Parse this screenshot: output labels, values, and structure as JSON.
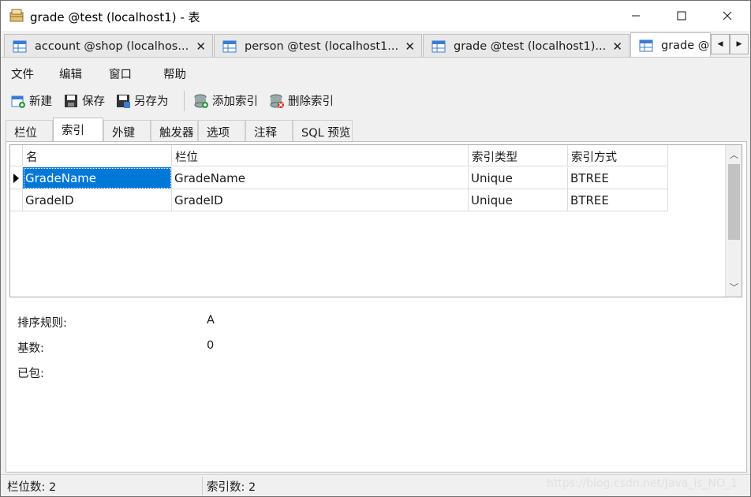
{
  "window": {
    "title": "grade @test (localhost1) - 表",
    "controls": {
      "minimize": "minimize",
      "maximize": "maximize",
      "close": "close"
    }
  },
  "doc_tabs": [
    {
      "label": "account @shop (localhos...",
      "active": false
    },
    {
      "label": "person @test (localhost1...",
      "active": false
    },
    {
      "label": "grade @test (localhost1)...",
      "active": false
    },
    {
      "label": "grade @t",
      "active": true
    }
  ],
  "menu": [
    "文件",
    "编辑",
    "窗口",
    "帮助"
  ],
  "toolbar": {
    "new": "新建",
    "save": "保存",
    "save_as": "另存为",
    "add_index": "添加索引",
    "delete_index": "删除索引"
  },
  "subtabs": [
    "栏位",
    "索引",
    "外键",
    "触发器",
    "选项",
    "注释",
    "SQL 预览"
  ],
  "active_subtab": "索引",
  "index_grid": {
    "columns": [
      "名",
      "栏位",
      "索引类型",
      "索引方式"
    ],
    "rows": [
      [
        "GradeName",
        "GradeName",
        "Unique",
        "BTREE"
      ],
      [
        "GradeID",
        "GradeID",
        "Unique",
        "BTREE"
      ]
    ]
  },
  "properties": [
    {
      "label": "排序规则:",
      "value": "A"
    },
    {
      "label": "基数:",
      "value": "0"
    },
    {
      "label": "已包:",
      "value": ""
    }
  ],
  "status": {
    "field_count": "栏位数: 2",
    "index_count": "索引数: 2",
    "watermark": "https://blog.csdn.net/Java_is_NO_1"
  },
  "colors": {
    "selection": "#0078d7",
    "accent_green": "#2e9b3e",
    "accent_red": "#d03020",
    "tab_icon_blue": "#3a7bd5"
  }
}
